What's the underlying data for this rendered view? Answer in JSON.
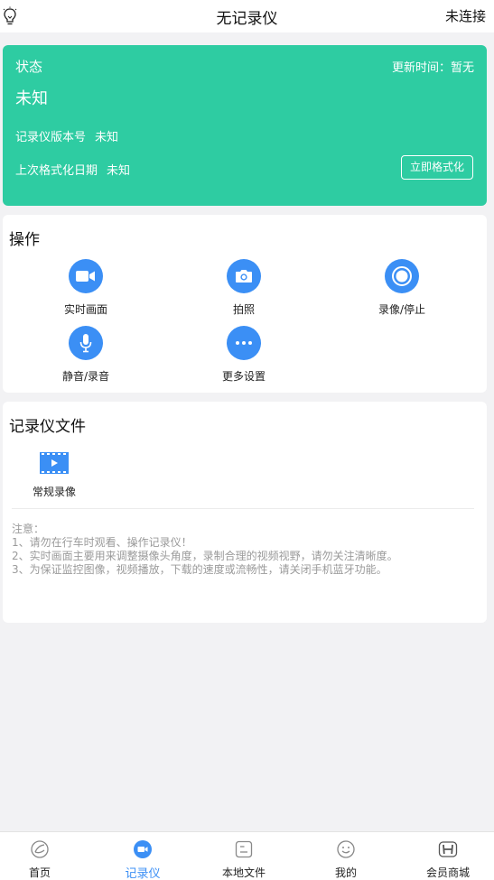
{
  "header": {
    "title": "无记录仪",
    "connection_status": "未连接"
  },
  "status": {
    "label": "状态",
    "update_time": "更新时间：暂无",
    "state_value": "未知",
    "version_label": "记录仪版本号",
    "version_value": "未知",
    "format_date_label": "上次格式化日期",
    "format_date_value": "未知",
    "format_button": "立即格式化",
    "card_color": "#2ecca2"
  },
  "operations": {
    "title": "操作",
    "items": [
      {
        "label": "实时画面",
        "icon": "video-camera-icon"
      },
      {
        "label": "拍照",
        "icon": "camera-icon"
      },
      {
        "label": "录像/停止",
        "icon": "record-icon"
      },
      {
        "label": "静音/录音",
        "icon": "microphone-icon"
      },
      {
        "label": "更多设置",
        "icon": "more-icon"
      }
    ],
    "accent_color": "#3b8ff5"
  },
  "files": {
    "title": "记录仪文件",
    "items": [
      {
        "label": "常规录像",
        "icon": "film-icon"
      }
    ],
    "notes": [
      "注意：",
      "1、请勿在行车时观看、操作记录仪！",
      "2、实时画面主要用来调整摄像头角度，录制合理的视频视野，请勿关注清晰度。",
      "3、为保证监控图像，视频播放，下载的速度或流畅性，请关闭手机蓝牙功能。"
    ]
  },
  "tabbar": {
    "tabs": [
      {
        "label": "首页",
        "icon": "home-icon"
      },
      {
        "label": "记录仪",
        "icon": "recorder-icon",
        "active": true
      },
      {
        "label": "本地文件",
        "icon": "local-file-icon"
      },
      {
        "label": "我的",
        "icon": "smile-icon"
      },
      {
        "label": "会员商城",
        "icon": "honda-logo-icon"
      }
    ]
  }
}
